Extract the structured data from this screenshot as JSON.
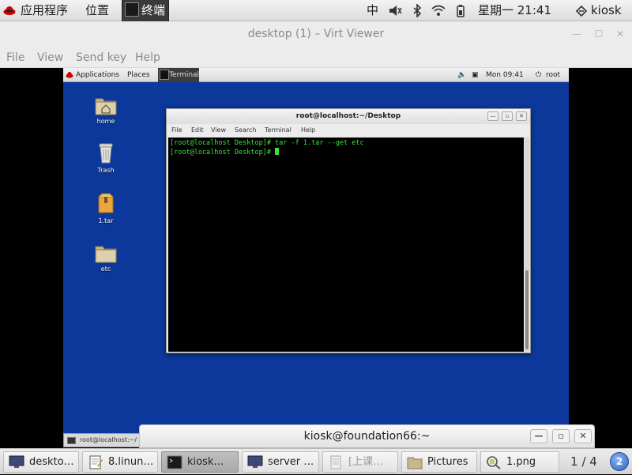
{
  "host_panel": {
    "applications": "应用程序",
    "places": "位置",
    "terminal_tab": "终端",
    "input_method": "中",
    "clock": "星期一 21:41",
    "user": "kiosk"
  },
  "window": {
    "title": "desktop (1) – Virt Viewer",
    "menu": [
      "File",
      "View",
      "Send key",
      "Help"
    ]
  },
  "guest": {
    "panel": {
      "applications": "Applications",
      "places": "Places",
      "terminal_tab": "Terminal",
      "clock": "Mon 09:41",
      "user": "root"
    },
    "desktop_icons": [
      {
        "label": "home",
        "icon": "home-folder-icon"
      },
      {
        "label": "Trash",
        "icon": "trash-icon"
      },
      {
        "label": "1.tar",
        "icon": "archive-icon"
      },
      {
        "label": "etc",
        "icon": "folder-icon"
      }
    ],
    "terminal": {
      "title": "root@localhost:~/Desktop",
      "menu": [
        "File",
        "Edit",
        "View",
        "Search",
        "Terminal",
        "Help"
      ],
      "lines": [
        "[root@localhost Desktop]# tar -f 1.tar --get etc",
        "[root@localhost Desktop]# "
      ]
    },
    "bottom_task": "root@localhost:~/"
  },
  "host_terminal_window": {
    "title": "kiosk@foundation66:~"
  },
  "taskbar": {
    "items": [
      {
        "label": "deskto…",
        "icon": "monitor-icon",
        "active": false
      },
      {
        "label": "8.linun…",
        "icon": "text-editor-icon",
        "active": false
      },
      {
        "label": "kiosk…",
        "icon": "terminal-icon",
        "active": true
      },
      {
        "label": "server …",
        "icon": "monitor-icon",
        "active": false
      },
      {
        "label": "[上课…",
        "icon": "document-icon",
        "active": false
      },
      {
        "label": "Pictures",
        "icon": "folder-icon",
        "active": false
      },
      {
        "label": "1.png",
        "icon": "image-viewer-icon",
        "active": false
      }
    ],
    "workspace": "1 / 4",
    "workspace_badge": "2"
  },
  "colors": {
    "guest_desktop": "#0b389a",
    "terminal_text": "#3de03d"
  }
}
